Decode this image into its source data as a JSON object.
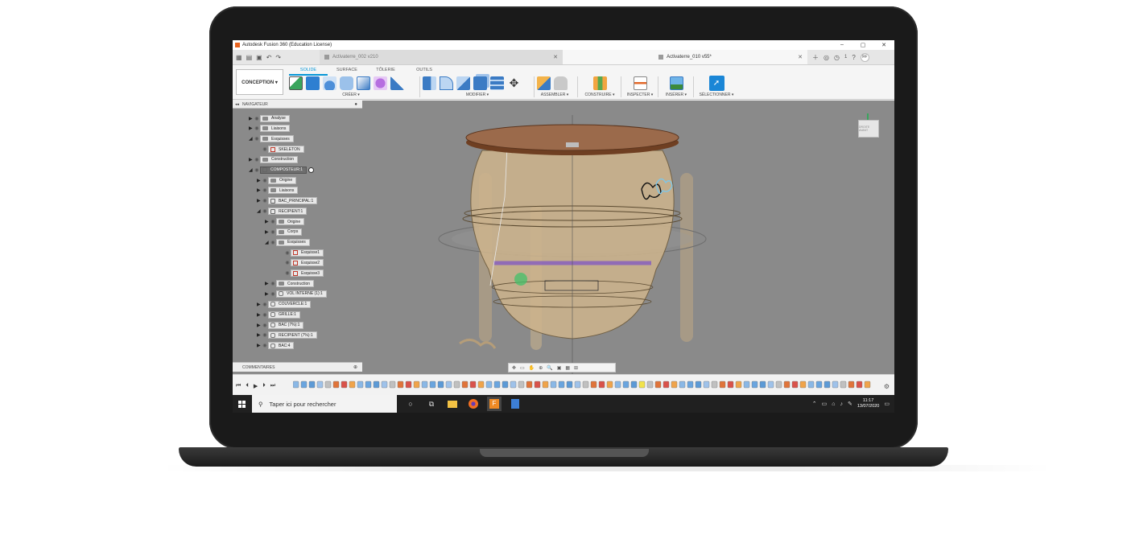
{
  "window": {
    "title": "Autodesk Fusion 360 (Education License)",
    "minimize": "–",
    "maximize": "▢",
    "close": "✕"
  },
  "tabs": [
    {
      "label": "Activaterre_002 v210",
      "active": false
    },
    {
      "label": "Activaterre_010 v55*",
      "active": true
    }
  ],
  "account": {
    "initials": "FF",
    "notifications": "1"
  },
  "ribbon": {
    "workspace": "CONCEPTION ▾",
    "tabs": [
      "SOLIDE",
      "SURFACE",
      "TÔLERIE",
      "OUTILS"
    ],
    "groups": {
      "create": "CRÉER ▾",
      "modify": "MODIFIER ▾",
      "assemble": "ASSEMBLER ▾",
      "construct": "CONSTRUIRE ▾",
      "inspect": "INSPECTER ▾",
      "insert": "INSÉRER ▾",
      "select": "SÉLECTIONNER ▾"
    }
  },
  "navigator": {
    "title": "NAVIGATEUR",
    "items": [
      {
        "label": "Analyse",
        "type": "folder",
        "level": 0,
        "arrow": "▶"
      },
      {
        "label": "Liaisons",
        "type": "folder",
        "level": 0,
        "arrow": "▶"
      },
      {
        "label": "Esquisses",
        "type": "folder",
        "level": 0,
        "arrow": "◢"
      },
      {
        "label": "SKELETON",
        "type": "sketch",
        "level": 1,
        "arrow": ""
      },
      {
        "label": "Construction",
        "type": "folder",
        "level": 0,
        "arrow": "▶"
      },
      {
        "label": "COMPOSTEUR:1",
        "type": "comp-active",
        "level": 0,
        "arrow": "◢"
      },
      {
        "label": "Origine",
        "type": "folder",
        "level": 1,
        "arrow": "▶"
      },
      {
        "label": "Liaisons",
        "type": "folder",
        "level": 1,
        "arrow": "▶"
      },
      {
        "label": "BAC_PRINCIPAL:1",
        "type": "comp",
        "level": 1,
        "arrow": "▶"
      },
      {
        "label": "RECIPIENT:1",
        "type": "comp",
        "level": 1,
        "arrow": "◢"
      },
      {
        "label": "Origine",
        "type": "folder",
        "level": 2,
        "arrow": "▶"
      },
      {
        "label": "Corps",
        "type": "folder",
        "level": 2,
        "arrow": "▶"
      },
      {
        "label": "Esquisses",
        "type": "folder",
        "level": 2,
        "arrow": "◢"
      },
      {
        "label": "Esquisse1",
        "type": "sketch",
        "level": 3,
        "arrow": ""
      },
      {
        "label": "Esquisse2",
        "type": "sketch",
        "level": 3,
        "arrow": ""
      },
      {
        "label": "Esquisse3",
        "type": "sketch",
        "level": 3,
        "arrow": ""
      },
      {
        "label": "Construction",
        "type": "folder",
        "level": 2,
        "arrow": "▶"
      },
      {
        "label": "VOL INTERNE (1):1",
        "type": "body",
        "level": 2,
        "arrow": "▶"
      },
      {
        "label": "COUVERCLE:1",
        "type": "body",
        "level": 1,
        "arrow": "▶"
      },
      {
        "label": "GRILLE:1",
        "type": "body",
        "level": 1,
        "arrow": "▶"
      },
      {
        "label": "BAC (7%):1",
        "type": "body",
        "level": 1,
        "arrow": "▶"
      },
      {
        "label": "RECIPIENT (7%):1",
        "type": "body",
        "level": 1,
        "arrow": "▶"
      },
      {
        "label": "BAC:4",
        "type": "body",
        "level": 1,
        "arrow": "▶"
      }
    ]
  },
  "comments": {
    "title": "COMMENTAIRES"
  },
  "viewcube": {
    "label": "DROITE AVANT"
  },
  "taskbar": {
    "search_placeholder": "Taper ici pour rechercher",
    "time": "11:17",
    "date": "13/07/2020"
  },
  "colors": {
    "accent": "#0696d7",
    "viewport": "#8a8a8a",
    "wood": "#8b5a3c",
    "body": "#cdb48d"
  }
}
